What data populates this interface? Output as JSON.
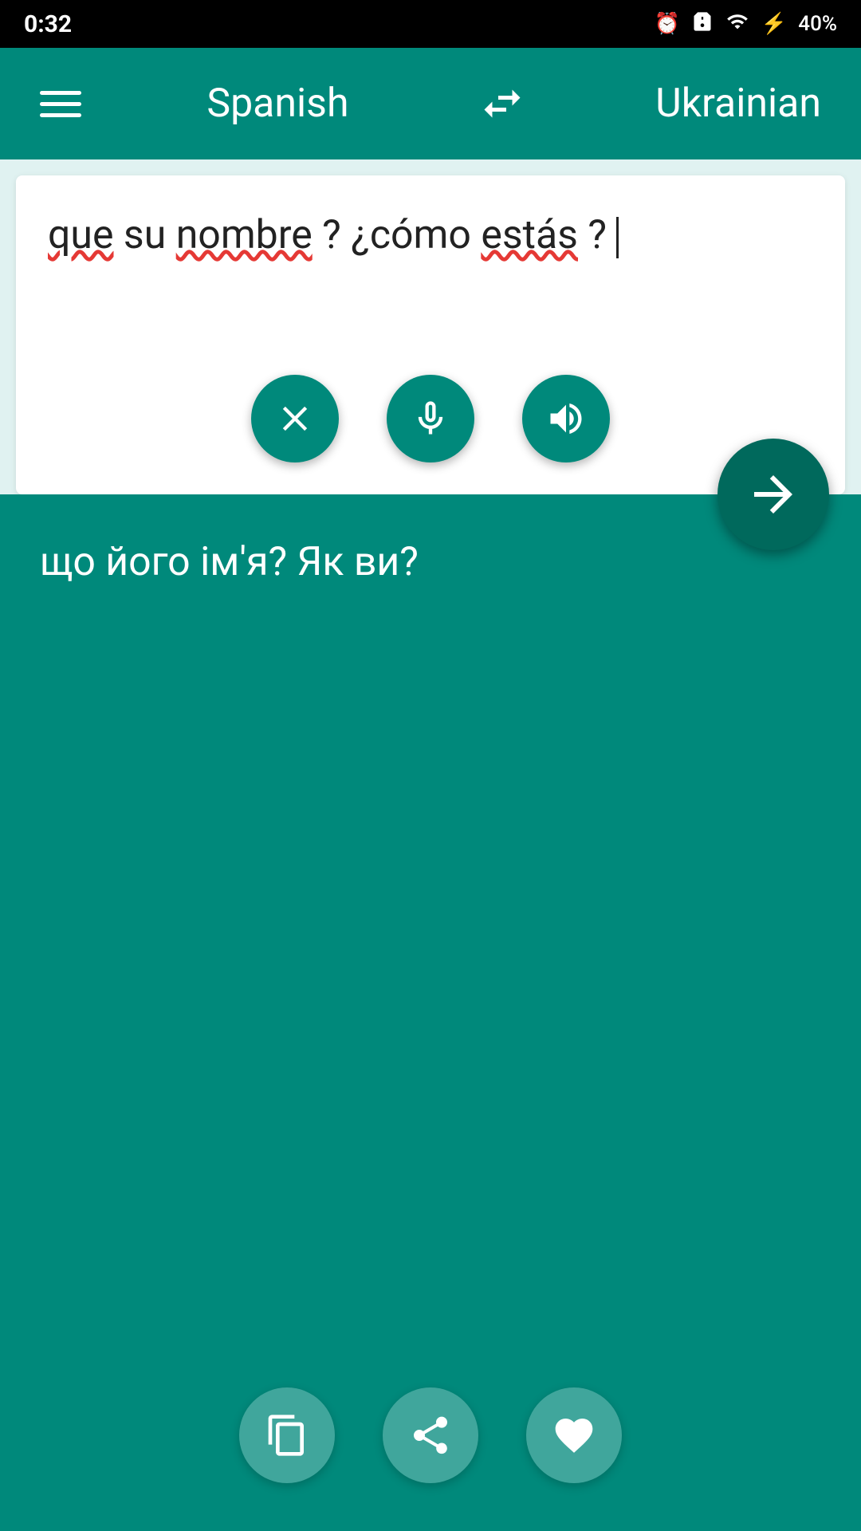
{
  "statusBar": {
    "time": "0:32",
    "battery": "40%"
  },
  "toolbar": {
    "menuLabel": "menu",
    "sourceLang": "Spanish",
    "swapLabel": "swap languages",
    "targetLang": "Ukrainian"
  },
  "sourcePanel": {
    "text": "que su nombre? ¿cómo estás?",
    "clearLabel": "clear",
    "micLabel": "microphone",
    "speakLabel": "speak"
  },
  "fab": {
    "translateLabel": "translate"
  },
  "targetPanel": {
    "text": "що його ім'я? Як ви?",
    "copyLabel": "copy",
    "shareLabel": "share",
    "favoriteLabel": "favorite"
  }
}
